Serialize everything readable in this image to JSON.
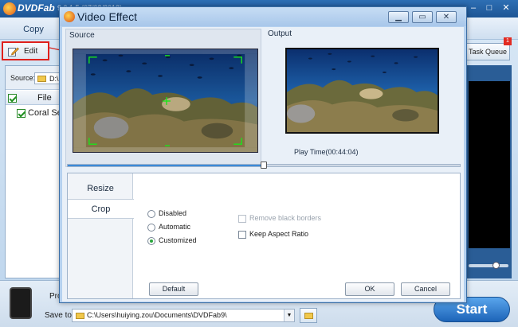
{
  "main_window": {
    "app_name": "DVDFab",
    "version_text": "9.0.1.5 (07/03/2013)",
    "copy_tab": "Copy",
    "edit_label": "Edit",
    "source_label": "Source:",
    "source_value": "D:\\m",
    "file_header": "File",
    "file_row": "Coral Sea",
    "task_queue_label": "Task Queue",
    "task_queue_count": "1",
    "profile_label": "Pro",
    "save_to_label": "Save to:",
    "save_path": "C:\\Users\\huiying.zou\\Documents\\DVDFab9\\",
    "start_label": "Start"
  },
  "dialog": {
    "title": "Video Effect",
    "source_title": "Source",
    "output_title": "Output",
    "play_time": "Play Time(00:44:04)",
    "timeline_progress": 0.5,
    "tabs": [
      {
        "label": "Resize",
        "selected": false
      },
      {
        "label": "Crop",
        "selected": true
      }
    ],
    "crop_modes": [
      {
        "label": "Disabled",
        "selected": false
      },
      {
        "label": "Automatic",
        "selected": false
      },
      {
        "label": "Customized",
        "selected": true
      }
    ],
    "options": {
      "remove_borders": "Remove black borders",
      "keep_aspect": "Keep Aspect Ratio"
    },
    "buttons": {
      "default": "Default",
      "ok": "OK",
      "cancel": "Cancel"
    }
  },
  "colors": {
    "crop_frame": "#19e619",
    "accent_blue": "#1d64b8",
    "highlight_red": "#e0201b"
  }
}
